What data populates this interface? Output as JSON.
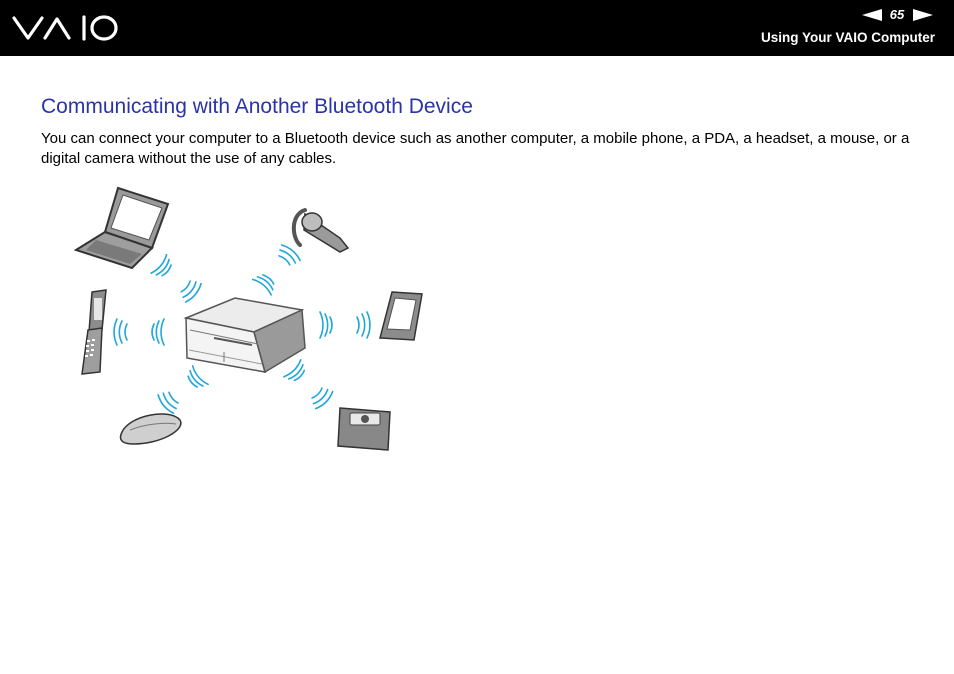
{
  "header": {
    "logo_text": "VAIO",
    "page_number": "65",
    "section_title": "Using Your VAIO Computer",
    "prev_icon": "left-triangle-arrow",
    "next_icon": "right-triangle-arrow"
  },
  "content": {
    "heading": "Communicating with Another Bluetooth Device",
    "body": "You can connect your computer to a Bluetooth device such as another computer, a mobile phone, a PDA, a headset, a mouse, or a digital camera without the use of any cables."
  },
  "illustration": {
    "devices": [
      "laptop",
      "headset",
      "flip-phone",
      "pda",
      "mouse",
      "digital-camera"
    ],
    "hub": "vaio-computer",
    "signal_color": "#1ea7d8"
  },
  "colors": {
    "header_bg": "#000000",
    "heading": "#2a33a8",
    "signal": "#1ea7d8"
  }
}
